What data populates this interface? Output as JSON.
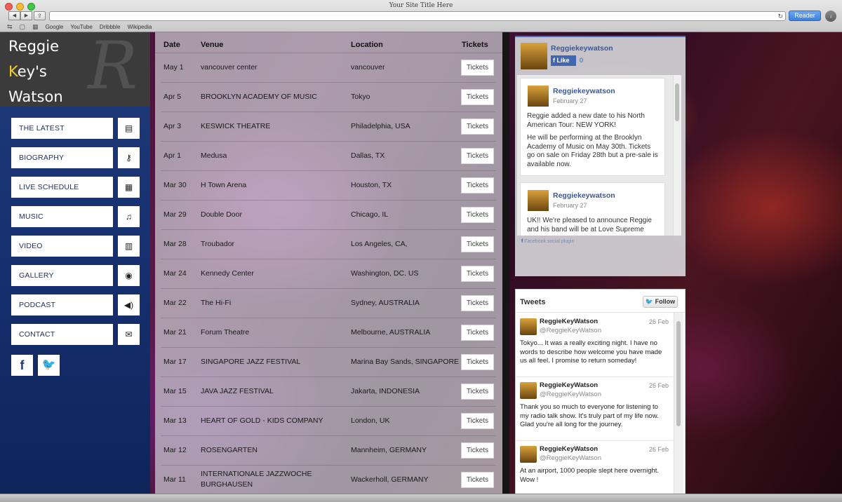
{
  "browser": {
    "window_title": "Your Site Title Here",
    "reader_label": "Reader",
    "bookmarks": [
      "Google",
      "YouTube",
      "Dribbble",
      "Wikipedia"
    ]
  },
  "logo": {
    "line1": "Reggie",
    "line2_k": "K",
    "line2_rest": "ey's",
    "line3": "Watson",
    "monogram": "R"
  },
  "menu": [
    {
      "label": "THE LATEST",
      "icon": "document-icon",
      "glyph": "▤"
    },
    {
      "label": "BIOGRAPHY",
      "icon": "key-icon",
      "glyph": "⚷"
    },
    {
      "label": "LIVE SCHEDULE",
      "icon": "calendar-icon",
      "glyph": "▦"
    },
    {
      "label": "MUSIC",
      "icon": "music-note-icon",
      "glyph": "♫"
    },
    {
      "label": "VIDEO",
      "icon": "film-icon",
      "glyph": "▥"
    },
    {
      "label": "GALLERY",
      "icon": "camera-icon",
      "glyph": "◉"
    },
    {
      "label": "PODCAST",
      "icon": "speaker-icon",
      "glyph": "◀)"
    },
    {
      "label": "CONTACT",
      "icon": "envelope-icon",
      "glyph": "✉"
    }
  ],
  "social": {
    "facebook": "f",
    "twitter": "🐦"
  },
  "tour": {
    "headers": {
      "date": "Date",
      "venue": "Venue",
      "location": "Location",
      "tickets": "Tickets"
    },
    "ticket_label": "Tickets",
    "rows": [
      {
        "date": "May 1",
        "venue": "vancouver center",
        "location": "vancouver"
      },
      {
        "date": "Apr 5",
        "venue": "BROOKLYN ACADEMY OF MUSIC",
        "location": "Tokyo"
      },
      {
        "date": "Apr 3",
        "venue": "KESWICK THEATRE",
        "location": "Philadelphia, USA"
      },
      {
        "date": "Apr 1",
        "venue": "Medusa",
        "location": "Dallas, TX"
      },
      {
        "date": "Mar 30",
        "venue": "H Town Arena",
        "location": "Houston, TX"
      },
      {
        "date": "Mar 29",
        "venue": "Double Door",
        "location": "Chicago, IL"
      },
      {
        "date": "Mar 28",
        "venue": "Troubador",
        "location": "Los Angeles, CA,"
      },
      {
        "date": "Mar 24",
        "venue": "Kennedy Center",
        "location": "Washington, DC. US"
      },
      {
        "date": "Mar 22",
        "venue": "The Hi-Fi",
        "location": "Sydney, AUSTRALIA"
      },
      {
        "date": "Mar 21",
        "venue": "Forum Theatre",
        "location": "Melbourne, AUSTRALIA"
      },
      {
        "date": "Mar 17",
        "venue": "SINGAPORE JAZZ FESTIVAL",
        "location": "Marina Bay Sands, SINGAPORE"
      },
      {
        "date": "Mar 15",
        "venue": "JAVA JAZZ FESTIVAL",
        "location": "Jakarta, INDONESIA"
      },
      {
        "date": "Mar 13",
        "venue": "HEART OF GOLD - KIDS COMPANY",
        "location": "London, UK"
      },
      {
        "date": "Mar 12",
        "venue": "ROSENGARTEN",
        "location": "Mannheim, GERMANY"
      },
      {
        "date": "Mar 11",
        "venue": "INTERNATIONALE JAZZWOCHE BURGHAUSEN",
        "location": "Wackerholl, GERMANY"
      }
    ]
  },
  "facebook": {
    "page_name": "Reggiekeywatson",
    "like_label": "Like",
    "like_count": "0",
    "posts": [
      {
        "name": "Reggiekeywatson",
        "date": "February 27",
        "text1": "Reggie added a new date to his North American Tour: NEW YORK!",
        "text2": "He will be performing at the Brooklyn Academy of Music on May 30th. Tickets go on sale on Friday 28th but a pre-sale is available now."
      },
      {
        "name": "Reggiekeywatson",
        "date": "February 27",
        "text1": "UK!! We're pleased to announce Reggie and his band will be at Love Supreme"
      }
    ],
    "plugin_label": "Facebook social plugin"
  },
  "twitter": {
    "title": "Tweets",
    "follow_label": "Follow",
    "tweets": [
      {
        "name": "ReggieKeyWatson",
        "handle": "@ReggieKeyWatson",
        "date": "26 Feb",
        "text": "Tokyo... It was a really exciting night. I have no words to describe how welcome you have made us all feel. I promise to return someday!"
      },
      {
        "name": "ReggieKeyWatson",
        "handle": "@ReggieKeyWatson",
        "date": "26 Feb",
        "text": "Thank you so much to everyone for listening to my radio talk show. It's truly part of my life now. Glad you're all long for the journey."
      },
      {
        "name": "ReggieKeyWatson",
        "handle": "@ReggieKeyWatson",
        "date": "26 Feb",
        "text": "At an airport, 1000 people slept here overnight. Wow !"
      }
    ]
  },
  "colors": {
    "sidebar": "#1f3a7a",
    "logo_accent": "#f2d02b",
    "fb_blue": "#3b5998",
    "reader_blue": "#3b7fdc"
  }
}
